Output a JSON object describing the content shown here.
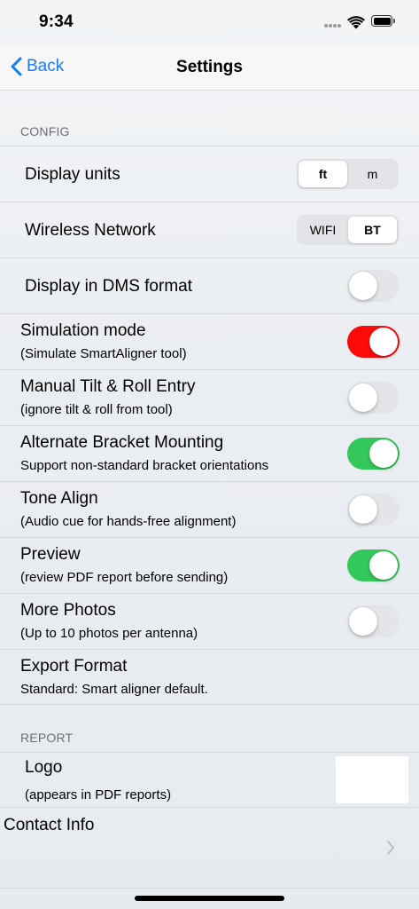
{
  "status": {
    "time": "9:34"
  },
  "nav": {
    "back_label": "Back",
    "title": "Settings"
  },
  "config": {
    "header": "CONFIG",
    "display_units": {
      "label": "Display units",
      "options": [
        "ft",
        "m"
      ],
      "selected": "ft"
    },
    "wireless_network": {
      "label": "Wireless Network",
      "options": [
        "WIFI",
        "BT"
      ],
      "selected": "BT"
    },
    "dms_format": {
      "label": "Display in DMS format",
      "on": false
    },
    "simulation_mode": {
      "label": "Simulation mode",
      "sub": "(Simulate SmartAligner tool)",
      "on": true,
      "on_color": "#ff0a0a"
    },
    "manual_tilt": {
      "label": "Manual Tilt & Roll Entry",
      "sub": "(ignore tilt & roll from tool)",
      "on": false
    },
    "alt_bracket": {
      "label": "Alternate Bracket Mounting",
      "sub": "Support non-standard bracket orientations",
      "on": true,
      "on_color": "#34c759"
    },
    "tone_align": {
      "label": "Tone Align",
      "sub": "(Audio cue for hands-free alignment)",
      "on": false
    },
    "preview": {
      "label": "Preview",
      "sub": "(review PDF report before sending)",
      "on": true,
      "on_color": "#34c759"
    },
    "more_photos": {
      "label": "More Photos",
      "sub": "(Up to 10 photos per antenna)",
      "on": false
    },
    "export_format": {
      "label": "Export Format",
      "sub": "Standard: Smart aligner default."
    }
  },
  "report": {
    "header": "REPORT",
    "logo": {
      "label": "Logo",
      "sub": "(appears in PDF reports)"
    },
    "contact_info": {
      "label": "Contact Info"
    }
  },
  "colors": {
    "accent": "#1a7cf5",
    "toggle_green": "#34c759",
    "toggle_red": "#ff0a0a",
    "toggle_off": "#e4e5e8"
  },
  "icons": [
    "back-chevron-icon",
    "signal-icon",
    "wifi-icon",
    "battery-icon",
    "chevron-right-icon"
  ]
}
